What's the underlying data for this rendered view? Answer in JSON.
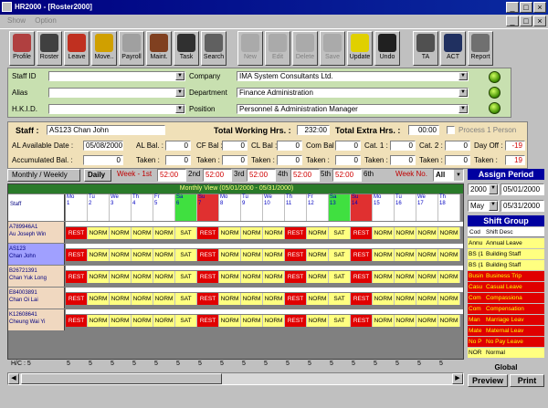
{
  "window": {
    "title": "HR2000 - [Roster2000]"
  },
  "menu": [
    "Show",
    "Option"
  ],
  "toolbar": [
    {
      "label": "Profile",
      "icon": "profile-icon",
      "enabled": true,
      "color": "#b04040"
    },
    {
      "label": "Roster",
      "icon": "clock-icon",
      "enabled": true,
      "color": "#404040"
    },
    {
      "label": "Leave",
      "icon": "leave-icon",
      "enabled": true,
      "color": "#c03020"
    },
    {
      "label": "Move..",
      "icon": "truck-icon",
      "enabled": true,
      "color": "#d0a000"
    },
    {
      "label": "Payroll",
      "icon": "money-bag-icon",
      "enabled": true,
      "color": "#a0a0a0"
    },
    {
      "label": "Maint.",
      "icon": "maintenance-icon",
      "enabled": true,
      "color": "#804020"
    },
    {
      "label": "Task",
      "icon": "task-icon",
      "enabled": true,
      "color": "#303030"
    },
    {
      "label": "Search",
      "icon": "search-icon",
      "enabled": true,
      "color": "#606060"
    },
    {
      "label": "New",
      "icon": "new-icon",
      "enabled": false,
      "color": "#808080"
    },
    {
      "label": "Edit",
      "icon": "edit-icon",
      "enabled": false,
      "color": "#808080"
    },
    {
      "label": "Delete",
      "icon": "delete-icon",
      "enabled": false,
      "color": "#808080"
    },
    {
      "label": "Save",
      "icon": "save-icon",
      "enabled": false,
      "color": "#808080"
    },
    {
      "label": "Update",
      "icon": "lightbulb-icon",
      "enabled": true,
      "color": "#e0d000"
    },
    {
      "label": "Undo",
      "icon": "undo-icon",
      "enabled": true,
      "color": "#202020"
    },
    {
      "label": "TA",
      "icon": "stopwatch-icon",
      "enabled": true,
      "color": "#505050"
    },
    {
      "label": "ACT",
      "icon": "act-icon",
      "enabled": true,
      "color": "#203060"
    },
    {
      "label": "Report",
      "icon": "printer-icon",
      "enabled": true,
      "color": "#707070"
    }
  ],
  "id_panel": {
    "staff_id_label": "Staff ID",
    "alias_label": "Alias",
    "hkid_label": "H.K.I.D.",
    "company_label": "Company",
    "department_label": "Department",
    "position_label": "Position",
    "company": "IMA System Consultants Ltd.",
    "department": "Finance Administration",
    "position": "Personnel & Administration Manager"
  },
  "staff": {
    "staff_label": "Staff :",
    "staff_value": "AS123 Chan John",
    "twh_label": "Total Working Hrs. :",
    "twh_value": "232:00",
    "teh_label": "Total Extra Hrs. :",
    "teh_value": "00:00",
    "process_label": "Process 1 Person",
    "al_date_label": "AL Available Date :",
    "al_date": "05/08/2000",
    "al_bal_label": "AL Bal. :",
    "al_bal": "0",
    "cf_bal_label": "CF Bal :",
    "cf_bal": "0",
    "cl_bal_label": "CL Bal :",
    "cl_bal": "0",
    "com_bal_label": "Com Bal :",
    "com_bal": "0",
    "cat1_label": "Cat. 1 :",
    "cat1": "0",
    "cat2_label": "Cat. 2 :",
    "cat2": "0",
    "dayoff_label": "Day Off :",
    "dayoff": "-19",
    "acc_label": "Accumulated Bal. :",
    "acc_bal": "0",
    "taken_label": "Taken :",
    "taken": "0",
    "total_bal": "19"
  },
  "weekbar": {
    "monthly_weekly": "Monthly / Weekly",
    "daily": "Daily",
    "week_label": "Week - 1st",
    "values": [
      "52:00",
      "52:00",
      "52:00",
      "52:00",
      "52:00",
      "52:00"
    ],
    "ord": [
      "2nd",
      "3rd",
      "4th",
      "5th",
      "6th"
    ],
    "weekno_label": "Week No.",
    "weekno": "All"
  },
  "grid": {
    "title": "Monthly View (05/01/2000 - 05/31/2000)",
    "staff_header": "Staff",
    "days": [
      [
        "Mo",
        "1"
      ],
      [
        "Tu",
        "2"
      ],
      [
        "We",
        "3"
      ],
      [
        "Th",
        "4"
      ],
      [
        "Fr",
        "5"
      ],
      [
        "Sa",
        "6"
      ],
      [
        "Su",
        "7"
      ],
      [
        "Mo",
        "8"
      ],
      [
        "Tu",
        "9"
      ],
      [
        "We",
        "10"
      ],
      [
        "Th",
        "11"
      ],
      [
        "Fr",
        "12"
      ],
      [
        "Sa",
        "13"
      ],
      [
        "Su",
        "14"
      ],
      [
        "Mo",
        "15"
      ],
      [
        "Tu",
        "16"
      ],
      [
        "We",
        "17"
      ],
      [
        "Th",
        "18"
      ]
    ],
    "day_colors": [
      "#fff",
      "#fff",
      "#fff",
      "#fff",
      "#fff",
      "#40e040",
      "#e03030",
      "#fff",
      "#fff",
      "#fff",
      "#fff",
      "#fff",
      "#40e040",
      "#e03030",
      "#fff",
      "#fff",
      "#fff",
      "#fff"
    ],
    "row_pattern": [
      "REST",
      "NORM",
      "NORM",
      "NORM",
      "NORM",
      "SAT",
      "REST",
      "NORM",
      "NORM",
      "NORM",
      "REST",
      "NORM",
      "SAT",
      "REST",
      "NORM",
      "NORM",
      "NORM",
      "NORM"
    ],
    "staff": [
      {
        "code": "A789946A1",
        "name": "Au Joseph Win"
      },
      {
        "code": "AS123",
        "name": "Chan John"
      },
      {
        "code": "B26721391",
        "name": "Chan Yuk Long"
      },
      {
        "code": "E84003891",
        "name": "Chan Oi Lai"
      },
      {
        "code": "K12608641",
        "name": "Cheung Wai Yi"
      }
    ],
    "hc_label": "H/C : 5",
    "bottom_value": "5"
  },
  "assign": {
    "title": "Assign Period",
    "year": "2000",
    "month": "May",
    "from": "05/01/2000",
    "to": "05/31/2000"
  },
  "shift_group": {
    "title": "Shift Group",
    "col_code": "Cod",
    "col_desc": "Shift Desc",
    "rows": [
      {
        "code": "Annu",
        "desc": "Annual Leave",
        "bg": "#ffff80",
        "fg": "#000"
      },
      {
        "code": "BS (1",
        "desc": "Building Staff",
        "bg": "#ffff80",
        "fg": "#000"
      },
      {
        "code": "BS (1",
        "desc": "Building Staff",
        "bg": "#ffff80",
        "fg": "#000"
      },
      {
        "code": "Busin",
        "desc": "Business Trip",
        "bg": "#e00000",
        "fg": "#ffff00"
      },
      {
        "code": "Casu",
        "desc": "Casual Leave",
        "bg": "#e00000",
        "fg": "#ffff00"
      },
      {
        "code": "Com",
        "desc": "Compassiona",
        "bg": "#e00000",
        "fg": "#ffff00"
      },
      {
        "code": "Com",
        "desc": "Compensation",
        "bg": "#e00000",
        "fg": "#ffff00"
      },
      {
        "code": "Man",
        "desc": "Marriage Leav",
        "bg": "#e00000",
        "fg": "#ffff00"
      },
      {
        "code": "Mate",
        "desc": "Maternal Leav",
        "bg": "#e00000",
        "fg": "#ffff00"
      },
      {
        "code": "No P",
        "desc": "No Pay Leave",
        "bg": "#e00000",
        "fg": "#ffff00"
      },
      {
        "code": "NOR",
        "desc": "Normal",
        "bg": "#ffff80",
        "fg": "#000"
      }
    ],
    "global_label": "Global",
    "preview_label": "Preview",
    "print_label": "Print"
  }
}
